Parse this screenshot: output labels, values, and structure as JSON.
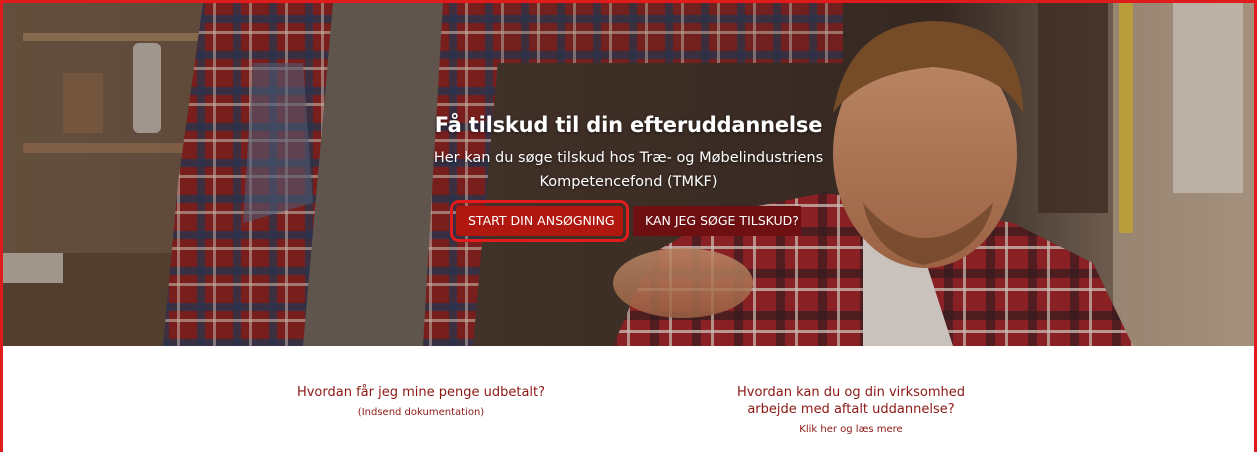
{
  "hero": {
    "title": "Få tilskud til din efteruddannelse",
    "subtitle_line1": "Her kan du søge tilskud hos Træ- og Møbelindustriens",
    "subtitle_line2": "Kompetencefond (TMKF)",
    "primary_button": "START DIN ANSØGNING",
    "secondary_button": "KAN JEG SØGE TILSKUD?"
  },
  "links": {
    "left": {
      "title": "Hvordan får jeg mine penge udbetalt?",
      "sub": "(Indsend dokumentation)"
    },
    "right": {
      "title_line1": "Hvordan kan du og din virksomhed",
      "title_line2": "arbejde med aftalt uddannelse?",
      "sub": "Klik her og læs mere"
    }
  },
  "colors": {
    "primary_button": "#b0180f",
    "secondary_button": "#6e0f12",
    "highlight_outline": "#e21c1c",
    "link_text": "#8b1713"
  }
}
